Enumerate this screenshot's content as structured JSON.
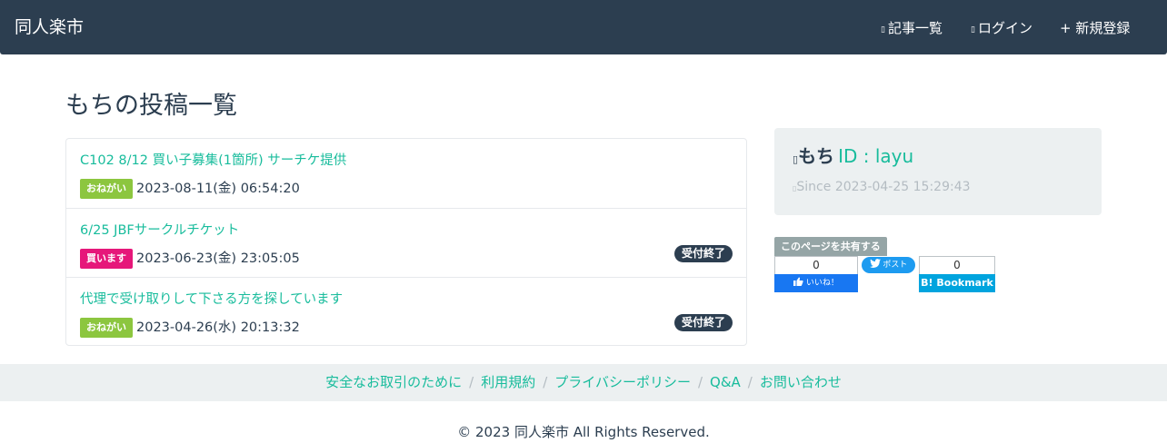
{
  "header": {
    "brand": "同人楽市",
    "nav": [
      {
        "icon": "list-icon",
        "icon_glyph": "▯",
        "label": "記事一覧"
      },
      {
        "icon": "login-icon",
        "icon_glyph": "▯",
        "label": "ログイン"
      },
      {
        "icon": "plus-icon",
        "icon_glyph": "+",
        "label": "新規登録"
      }
    ]
  },
  "main": {
    "title": "もちの投稿一覧",
    "posts": [
      {
        "title": "C102 8/12 買い子募集(1箇所) サーチケ提供",
        "tag": "おねがい",
        "tag_color": "#8cc63f",
        "date": "2023-08-11(金) 06:54:20",
        "status": ""
      },
      {
        "title": "6/25 JBFサークルチケット",
        "tag": "買います",
        "tag_color": "#e6177a",
        "date": "2023-06-23(金) 23:05:05",
        "status": "受付終了"
      },
      {
        "title": "代理で受け取りして下さる方を探しています",
        "tag": "おねがい",
        "tag_color": "#8cc63f",
        "date": "2023-04-26(水) 20:13:32",
        "status": "受付終了"
      }
    ]
  },
  "profile": {
    "icon": "user-icon",
    "icon_glyph": "▯",
    "name": "もち",
    "id_text": "ID : layu",
    "since_icon": "clock-icon",
    "since_glyph": "▯",
    "since": "Since 2023-04-25 15:29:43"
  },
  "share": {
    "label": "このページを共有する",
    "facebook_count": "0",
    "facebook_label": "いいね！",
    "twitter_label": "ポスト",
    "hatena_count": "0",
    "hatena_label": "B! Bookmark"
  },
  "footer": {
    "links": [
      "安全なお取引のために",
      "利用規約",
      "プライバシーポリシー",
      "Q&A",
      "お問い合わせ"
    ],
    "separator": "/",
    "copyright": "© 2023 同人楽市 All Rights Reserved."
  },
  "colors": {
    "navbar": "#2c3e50",
    "accent": "#18bc9c",
    "panel": "#ecf0f1"
  }
}
